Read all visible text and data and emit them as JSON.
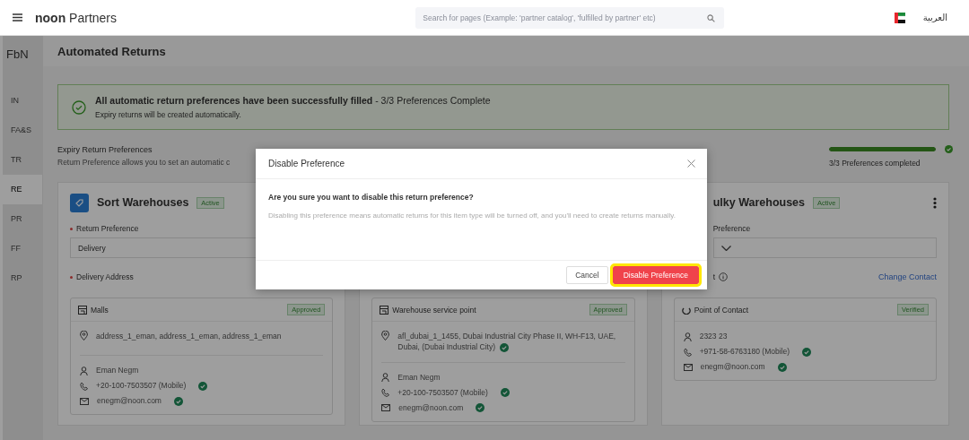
{
  "header": {
    "brand_bold": "noon",
    "brand_rest": "Partners",
    "search_placeholder": "Search for pages (Example: 'partner catalog', 'fulfilled by partner' etc)",
    "language": "العربية"
  },
  "sidebar": {
    "title": "FbN",
    "items": [
      {
        "label": "IN",
        "selected": false
      },
      {
        "label": "FA&S",
        "selected": false
      },
      {
        "label": "TR",
        "selected": false
      },
      {
        "label": "RE",
        "selected": true
      },
      {
        "label": "PR",
        "selected": false
      },
      {
        "label": "FF",
        "selected": false
      },
      {
        "label": "RP",
        "selected": false
      }
    ]
  },
  "page_title": "Automated Returns",
  "banner": {
    "text": "**All automatic return preferences have been successfully filled** - 3/3 Preferences Complete",
    "subtitle": "Expiry returns will be created automatically."
  },
  "preferences": {
    "title": "Expiry Return Preferences",
    "description": "Return Preference allows you to set an automatic c",
    "progress": {
      "level": 1,
      "label": "3/3 Preferences completed",
      "complete": true
    }
  },
  "cards": [
    {
      "title": "Sort Warehouses",
      "status": "Active",
      "field": {
        "label": "Return Preference",
        "required": true,
        "value": "Delivery"
      },
      "address_label": {
        "label": "Delivery Address",
        "required": true
      },
      "box": {
        "kind": "address",
        "title": "Malls",
        "badge": "Approved",
        "address": "address_1_eman, address_1_eman, address_1_eman",
        "name": "Eman Negm",
        "phone": "+20-100-7503507 (Mobile)",
        "phone_verified": true,
        "email": "enegm@noon.com",
        "email_verified": true
      }
    },
    {
      "box": {
        "kind": "address",
        "title": "Warehouse service point",
        "badge": "Approved",
        "address": "afl_dubai_1_1455, Dubai Industrial City Phase II, WH-F13, UAE, Dubai, (Dubai Industrial City)",
        "address_verified": true,
        "name": "Eman Negm",
        "phone": "+20-100-7503507 (Mobile)",
        "phone_verified": true,
        "email": "enegm@noon.com",
        "email_verified": true
      }
    },
    {
      "covered_left": true,
      "title": "ulky Warehouses",
      "status": "Active",
      "menu": true,
      "field": {
        "label": "Preference",
        "chevron": true
      },
      "address_label": {
        "label": "t",
        "info": true
      },
      "link": "Change Contact",
      "box": {
        "kind": "contact",
        "title": "Point of Contact",
        "badge": "Verified",
        "name": "2323 23",
        "phone": "+971-58-6763180 (Mobile)",
        "phone_verified": true,
        "email": "enegm@noon.com",
        "email_verified": true
      }
    }
  ],
  "dialog": {
    "title": "Disable Preference",
    "question": "Are you sure you want to disable this return preference?",
    "message": "Disabling this preference means automatic returns for this item type will be turned off, and you'll need to create returns manually.",
    "buttons": [
      {
        "label": "Cancel",
        "kind": "secondary",
        "highlighted": false
      },
      {
        "label": "Disable Preference",
        "kind": "danger",
        "highlighted": true
      }
    ]
  }
}
